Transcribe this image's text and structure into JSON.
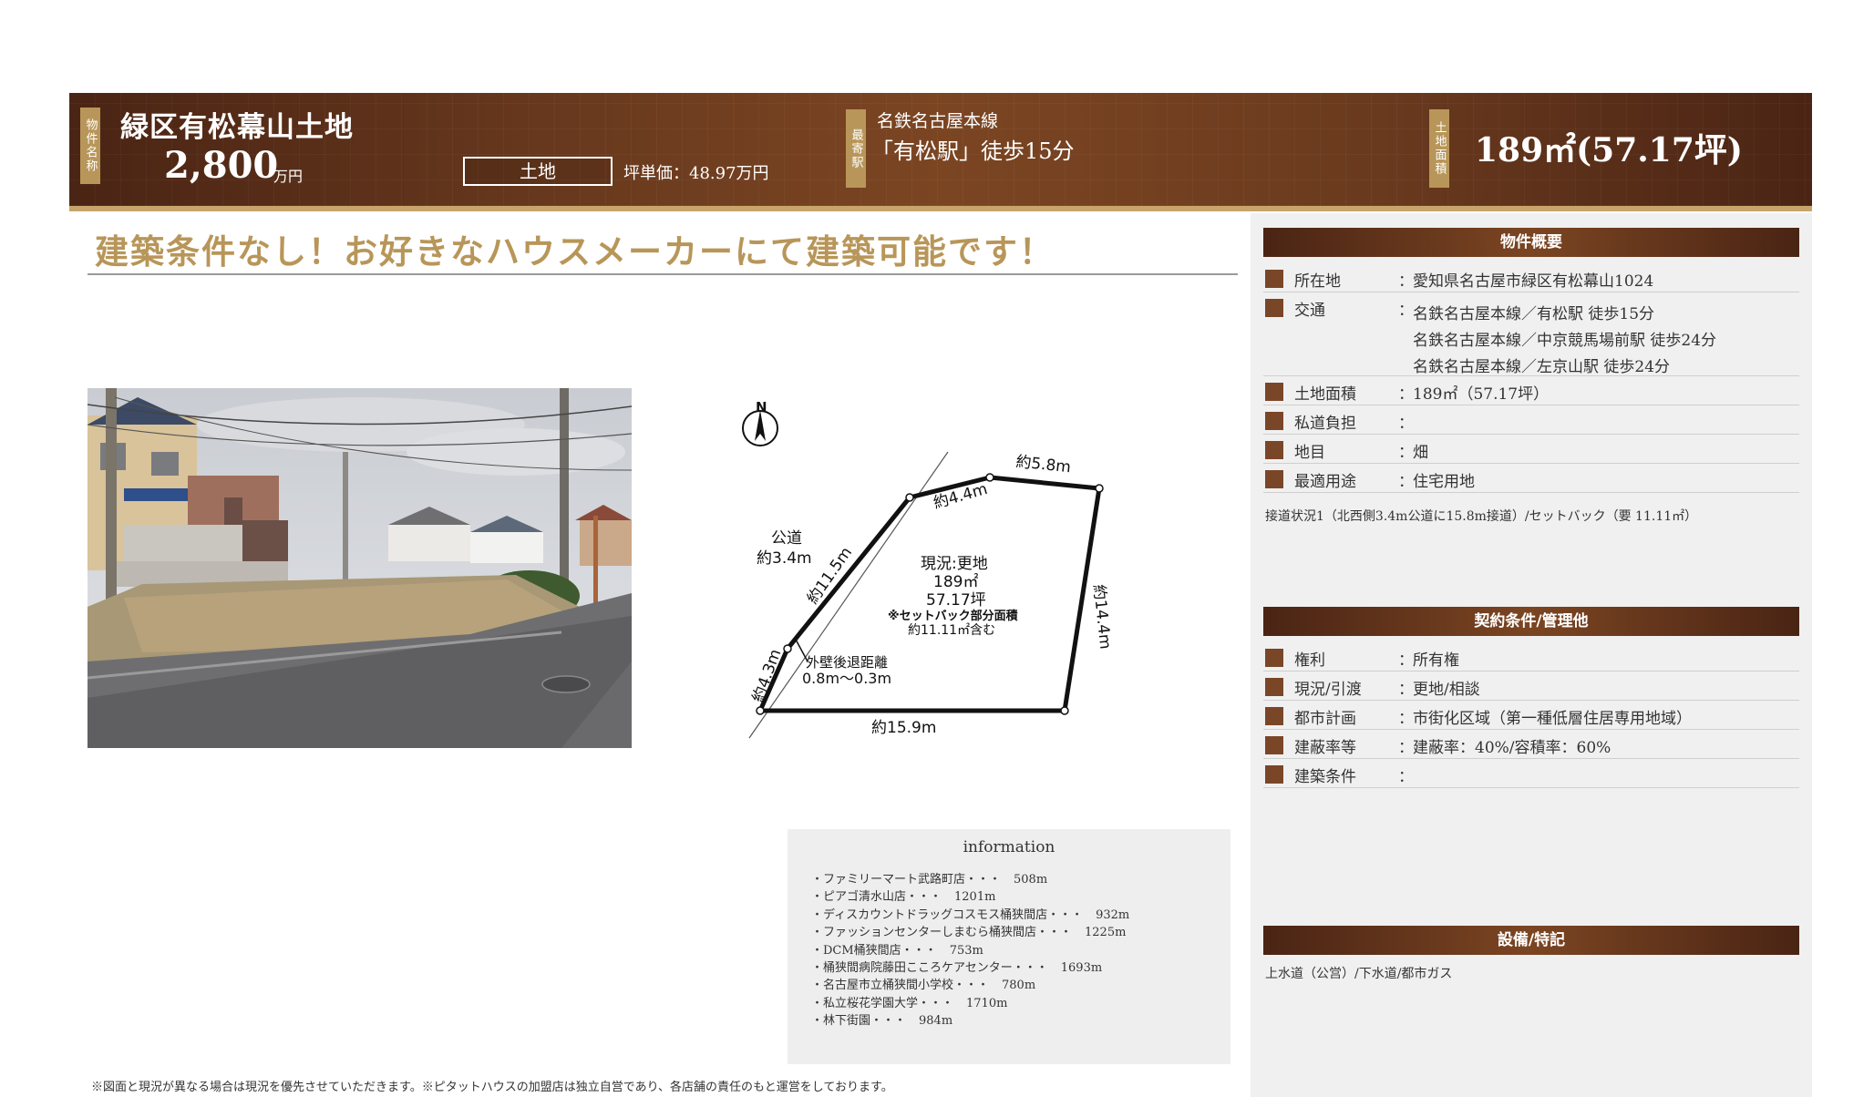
{
  "banner": {
    "name_label": "物件名称",
    "property_name": "緑区有松幕山土地",
    "price": "2,800",
    "price_unit": "万円",
    "property_type": "土地",
    "tsubo_price": "坪単価：48.97万円",
    "station_label": "最寄駅",
    "station_line": "名鉄名古屋本線",
    "station_walk": "「有松駅」徒歩15分",
    "area_label": "土地面積",
    "land_area": "189㎡(57.17坪)"
  },
  "headline": "建築条件なし！お好きなハウスメーカーにて建築可能です！",
  "plan": {
    "north": "N",
    "road_label": "公道",
    "road_width": "約3.4m",
    "side_top_a": "約4.4m",
    "side_top_b": "約5.8m",
    "side_right": "約14.4m",
    "side_bottom": "約15.9m",
    "side_left_long": "約11.5m",
    "side_left_short": "約4.3m",
    "status": "現況:更地",
    "area_m2": "189㎡",
    "area_tsubo": "57.17坪",
    "setback_note": "※セットバック部分面積",
    "setback_area": "約11.11㎡含む",
    "wall_label": "外壁後退距離",
    "wall_distance": "0.8m〜0.3m"
  },
  "info": {
    "title": "information",
    "items": [
      {
        "name": "・ファミリーマート武路町店・・・",
        "dist": "508m"
      },
      {
        "name": "・ピアゴ清水山店・・・",
        "dist": "1201m"
      },
      {
        "name": "・ディスカウントドラッグコスモス桶狭間店・・・",
        "dist": "932m"
      },
      {
        "name": "・ファッションセンターしまむら桶狭間店・・・",
        "dist": "1225m"
      },
      {
        "name": "・DCM桶狭間店・・・",
        "dist": "753m"
      },
      {
        "name": "・桶狭間病院藤田こころケアセンター・・・",
        "dist": "1693m"
      },
      {
        "name": "・名古屋市立桶狭間小学校・・・",
        "dist": "780m"
      },
      {
        "name": "・私立桜花学園大学・・・",
        "dist": "1710m"
      },
      {
        "name": "・林下街園・・・",
        "dist": "984m"
      }
    ]
  },
  "footnote": "※図面と現況が異なる場合は現況を優先させていただきます。※ピタットハウスの加盟店は独立自営であり、各店舗の責任のもと運営をしております。",
  "overview": {
    "title": "物件概要",
    "location_key": "所在地",
    "location_val": "愛知県名古屋市緑区有松幕山1024",
    "transport_key": "交通",
    "transport_vals": [
      "名鉄名古屋本線／有松駅 徒歩15分",
      "名鉄名古屋本線／中京競馬場前駅 徒歩24分",
      "名鉄名古屋本線／左京山駅 徒歩24分"
    ],
    "area_key": "土地面積",
    "area_val": "189㎡（57.17坪）",
    "private_road_key": "私道負担",
    "private_road_val": "",
    "land_category_key": "地目",
    "land_category_val": "畑",
    "use_key": "最適用途",
    "use_val": "住宅用地",
    "road_note": "接道状況1（北西側3.4m公道に15.8m接道）/セットバック（要 11.11㎡）"
  },
  "contract": {
    "title": "契約条件/管理他",
    "rights_key": "権利",
    "rights_val": "所有権",
    "status_key": "現況/引渡",
    "status_val": "更地/相談",
    "planning_key": "都市計画",
    "planning_val": "市街化区域（第一種低層住居専用地域）",
    "ratio_key": "建蔽率等",
    "ratio_val": "建蔽率：40%/容積率：60%",
    "condition_key": "建築条件",
    "condition_val": ""
  },
  "facilities": {
    "title": "設備/特記",
    "text": "上水道（公営）/下水道/都市ガス"
  },
  "colors": {
    "brand_brown": "#6a3a1e",
    "accent_gold": "#b89659",
    "marker": "#7a4628"
  }
}
